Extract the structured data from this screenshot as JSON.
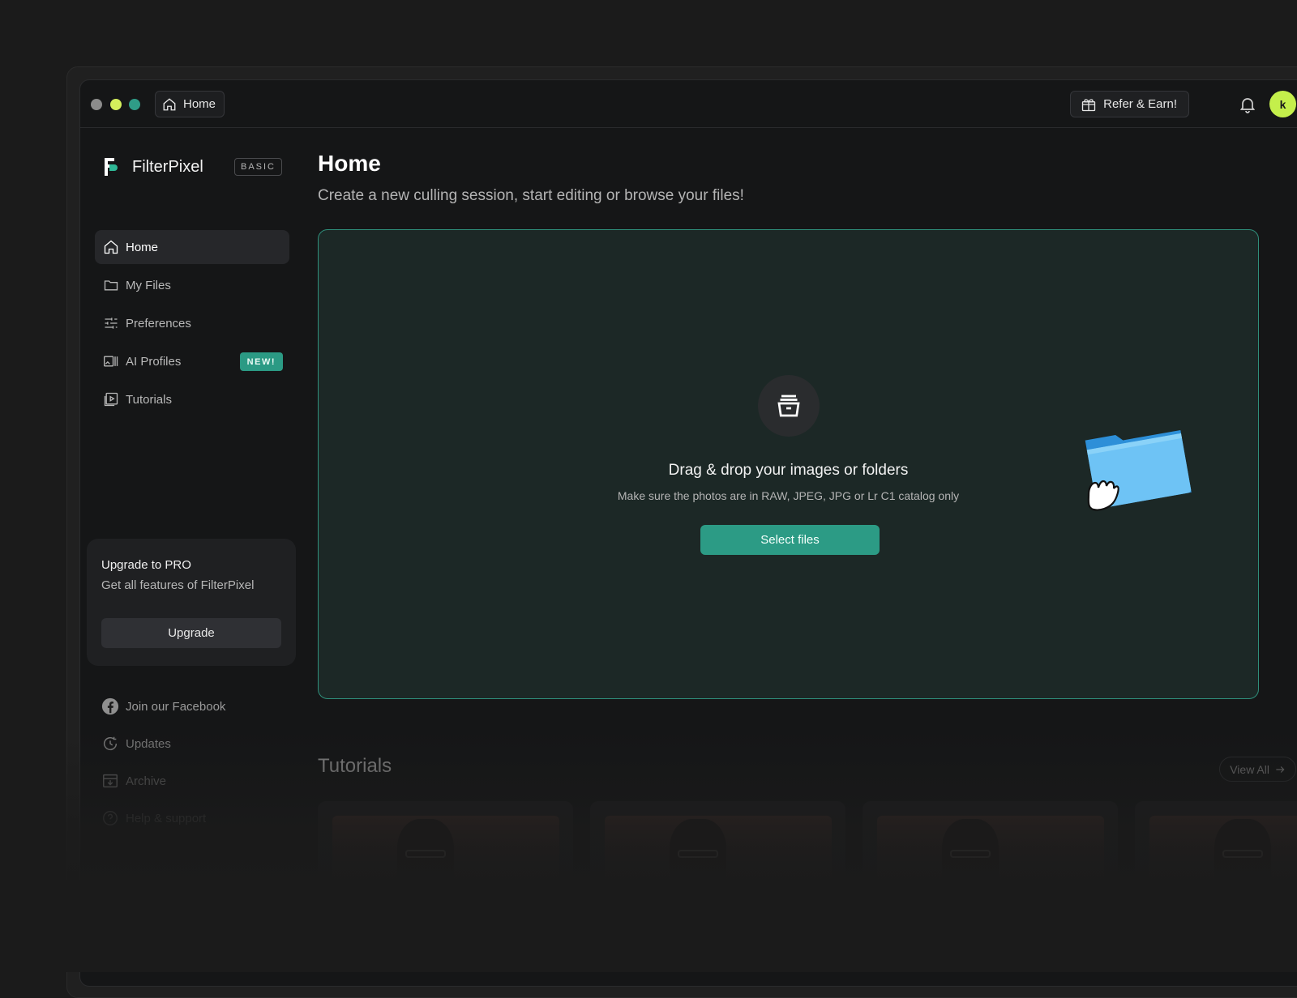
{
  "titlebar": {
    "tab_label": "Home",
    "refer_label": "Refer & Earn!",
    "avatar_initial": "k"
  },
  "sidebar": {
    "app_name": "FilterPixel",
    "plan_badge": "BASIC",
    "items": [
      {
        "label": "Home",
        "icon": "home-icon",
        "active": true
      },
      {
        "label": "My Files",
        "icon": "folder-icon"
      },
      {
        "label": "Preferences",
        "icon": "sliders-icon"
      },
      {
        "label": "AI Profiles",
        "icon": "ai-profiles-icon",
        "badge": "NEW!"
      },
      {
        "label": "Tutorials",
        "icon": "play-video-icon"
      }
    ],
    "upgrade": {
      "title": "Upgrade to PRO",
      "subtitle": "Get all features of FilterPixel",
      "button": "Upgrade"
    },
    "footer": [
      {
        "label": "Join our Facebook",
        "icon": "facebook-icon"
      },
      {
        "label": "Updates",
        "icon": "updates-icon"
      },
      {
        "label": "Archive",
        "icon": "archive-icon"
      },
      {
        "label": "Help & support",
        "icon": "help-icon"
      }
    ]
  },
  "main": {
    "title": "Home",
    "subtitle": "Create a new culling session, start editing or browse your files!",
    "dropzone": {
      "title": "Drag & drop your images or folders",
      "subtitle": "Make sure the photos are in RAW, JPEG, JPG or Lr C1 catalog only",
      "button": "Select files"
    },
    "tutorials": {
      "title": "Tutorials",
      "view_all": "View All"
    }
  },
  "colors": {
    "accent": "#2c9b85",
    "avatar": "#c4ef4b",
    "background": "#151617"
  }
}
